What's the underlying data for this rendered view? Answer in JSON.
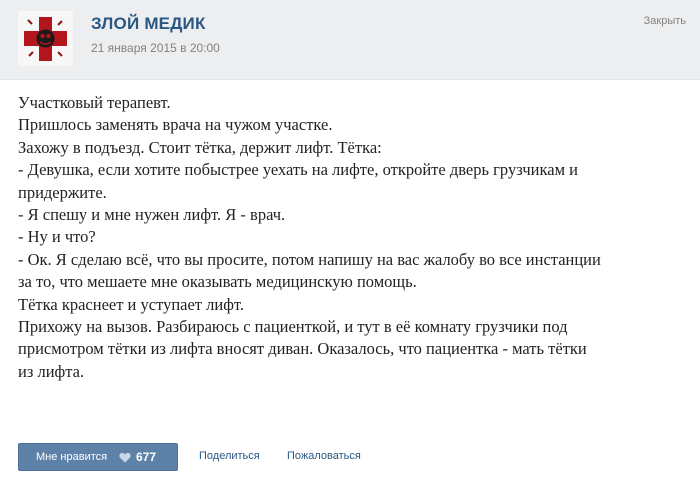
{
  "post": {
    "author": "ЗЛОЙ МЕДИК",
    "date": "21 января 2015 в 20:00",
    "close_label": "Закрыть",
    "avatar_icon": "red-cross-icon",
    "body_lines": [
      "Участковый терапевт.",
      "Пришлось заменять врача на чужом участке.",
      "Захожу в подъезд. Стоит тётка, держит лифт. Тётка:",
      "- Девушка, если хотите побыстрее уехать на лифте, откройте дверь грузчикам и",
      "придержите.",
      "- Я спешу и мне нужен лифт. Я - врач.",
      "- Ну и что?",
      "- Ок. Я сделаю всё, что вы просите, потом напишу на вас жалобу во все инстанции",
      "за то, что мешаете мне оказывать медицинскую помощь.",
      "Тётка краснеет и уступает лифт.",
      "Прихожу на вызов. Разбираюсь с пациенткой, и тут в её комнату грузчики под",
      "присмотром тётки из лифта вносят диван. Оказалось, что пациентка - мать тётки",
      "из лифта."
    ]
  },
  "footer": {
    "like_label": "Мне нравится",
    "like_icon": "heart-icon",
    "like_count": "677",
    "share_label": "Поделиться",
    "report_label": "Пожаловаться"
  },
  "colors": {
    "header_bg": "#edeef0",
    "link": "#2a5885",
    "like_button": "#5e81a8",
    "avatar_red": "#b3151d"
  }
}
